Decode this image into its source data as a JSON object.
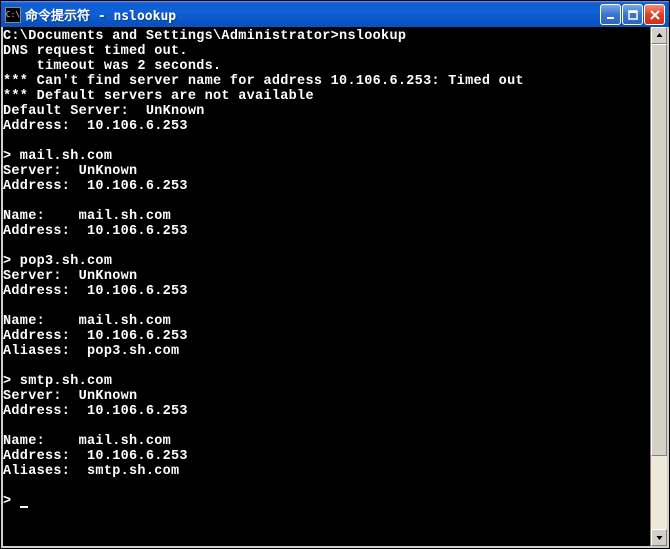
{
  "titlebar": {
    "icon_text": "C:\\",
    "title": "命令提示符 - nslookup"
  },
  "console": {
    "prompt_line": "C:\\Documents and Settings\\Administrator>nslookup",
    "dns_timeout1": "DNS request timed out.",
    "dns_timeout2": "    timeout was 2 seconds.",
    "err1": "*** Can't find server name for address 10.106.6.253: Timed out",
    "err2": "*** Default servers are not available",
    "def_server": "Default Server:  UnKnown",
    "def_address": "Address:  10.106.6.253",
    "q1_prompt": "> mail.sh.com",
    "q1_server": "Server:  UnKnown",
    "q1_address": "Address:  10.106.6.253",
    "q1_name": "Name:    mail.sh.com",
    "q1_name_addr": "Address:  10.106.6.253",
    "q2_prompt": "> pop3.sh.com",
    "q2_server": "Server:  UnKnown",
    "q2_address": "Address:  10.106.6.253",
    "q2_name": "Name:    mail.sh.com",
    "q2_name_addr": "Address:  10.106.6.253",
    "q2_aliases": "Aliases:  pop3.sh.com",
    "q3_prompt": "> smtp.sh.com",
    "q3_server": "Server:  UnKnown",
    "q3_address": "Address:  10.106.6.253",
    "q3_name": "Name:    mail.sh.com",
    "q3_name_addr": "Address:  10.106.6.253",
    "q3_aliases": "Aliases:  smtp.sh.com",
    "final_prompt": "> "
  }
}
